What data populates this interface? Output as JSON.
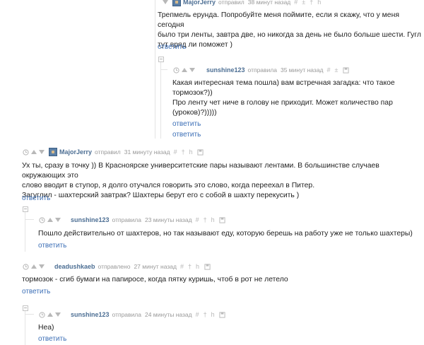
{
  "comments": [
    {
      "author": "MajorJerry",
      "action": "отправил",
      "time": "38 минут назад",
      "avatar": true,
      "text": "Трепмель ерунда. Попробуйте меня поймите, если я скажу, что у меня сегодня\nбыло три ленты, завтра две, но никогда за день не было больше шести. Гугл\nтут вряд ли поможет )",
      "reply_label": "ответить"
    },
    {
      "author": "sunshine123",
      "action": "отправила",
      "time": "35 минут назад",
      "avatar": false,
      "text": "Какая интересная тема пошла) вам встречная загадка: что такое\nтормозок?))\nПро ленту чет ниче в голову не приходит. Может количество пар\n(уроков)?)))))",
      "reply_label": "ответить"
    },
    {
      "author": "MajorJerry",
      "action": "отправил",
      "time": "31 минуту назад",
      "avatar": true,
      "text": "Ух ты, сразу в точку )) В Красноярске университетские пары называют лентами. В большинстве случаев окружающих это\nслово вводит в ступор, я долго отучался говорить это слово, когда переехал в Питер.\nЗагуглил - шахтерский завтрак? Шахтеры берут его с собой в шахту перекусить )",
      "reply_label": "ответить"
    },
    {
      "author": "sunshine123",
      "action": "отправила",
      "time": "23 минуты назад",
      "avatar": false,
      "text": "Пошло действительно от шахтеров, но так называют еду, которую берешь на работу уже не только шахтеры)",
      "reply_label": "ответить"
    },
    {
      "author": "deadushkaeb",
      "action": "отправлено",
      "time": "27 минут назад",
      "avatar": false,
      "text": "тормозок - сгиб бумаги на папиросе, когда пятку куришь, чтоб в рот не летело",
      "reply_label": "ответить"
    },
    {
      "author": "sunshine123",
      "action": "отправила",
      "time": "24 минуты назад",
      "avatar": false,
      "text": "Неа)",
      "reply_label": "ответить"
    }
  ],
  "icons": {
    "clock": "clock-icon",
    "upvote": "upvote-icon",
    "downvote": "downvote-icon",
    "link": "hash-link-icon",
    "plus": "plus-icon",
    "pin": "pin-icon",
    "flag": "flag-icon",
    "save": "save-icon"
  },
  "colors": {
    "author": "#4d6f94",
    "reply_link": "#3c6fb6",
    "meta": "#9a9a9a",
    "thread_line": "#e4e4e4"
  }
}
